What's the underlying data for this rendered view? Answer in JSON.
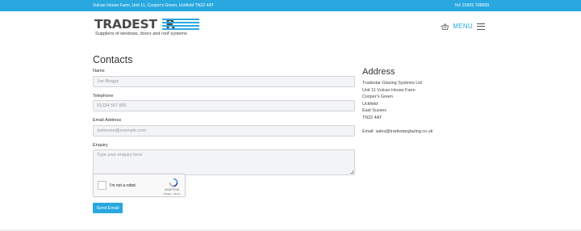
{
  "topbar": {
    "address": "Vulcan House Farm, Unit 11, Cooper's Green, Uckfield TN22 4AT",
    "phone": "Tel: 01825 708999"
  },
  "logo": {
    "word": "TRADESTAR",
    "tagline": "Suppliers of windows, doors and roof systems"
  },
  "nav": {
    "menu_label": "MENU",
    "basket_icon": "basket-icon",
    "menu_icon": "hamburger-icon"
  },
  "form": {
    "title": "Contacts",
    "name_label": "Name",
    "name_placeholder": "Joe Bloggs",
    "phone_label": "Telephone",
    "phone_placeholder": "01234 567 890",
    "email_label": "Email Address",
    "email_placeholder": "someone@example.com",
    "enquiry_label": "Enquiry",
    "enquiry_placeholder": "Type your enquiry here",
    "captcha_label": "I'm not a robot",
    "captcha_brand": "reCAPTCHA",
    "captcha_terms": "Privacy - Terms",
    "send_label": "Send Email"
  },
  "address": {
    "title": "Address",
    "lines": [
      "Tradestar Glazing Systems Ltd",
      "Unit 11 Vulcan House Farm",
      "Cooper's Green",
      "Uckfield",
      "East Sussex",
      "TN22 4AT"
    ],
    "email": "Email: sales@tradestarglazing.co.uk"
  },
  "colors": {
    "accent": "#29a8e0"
  }
}
